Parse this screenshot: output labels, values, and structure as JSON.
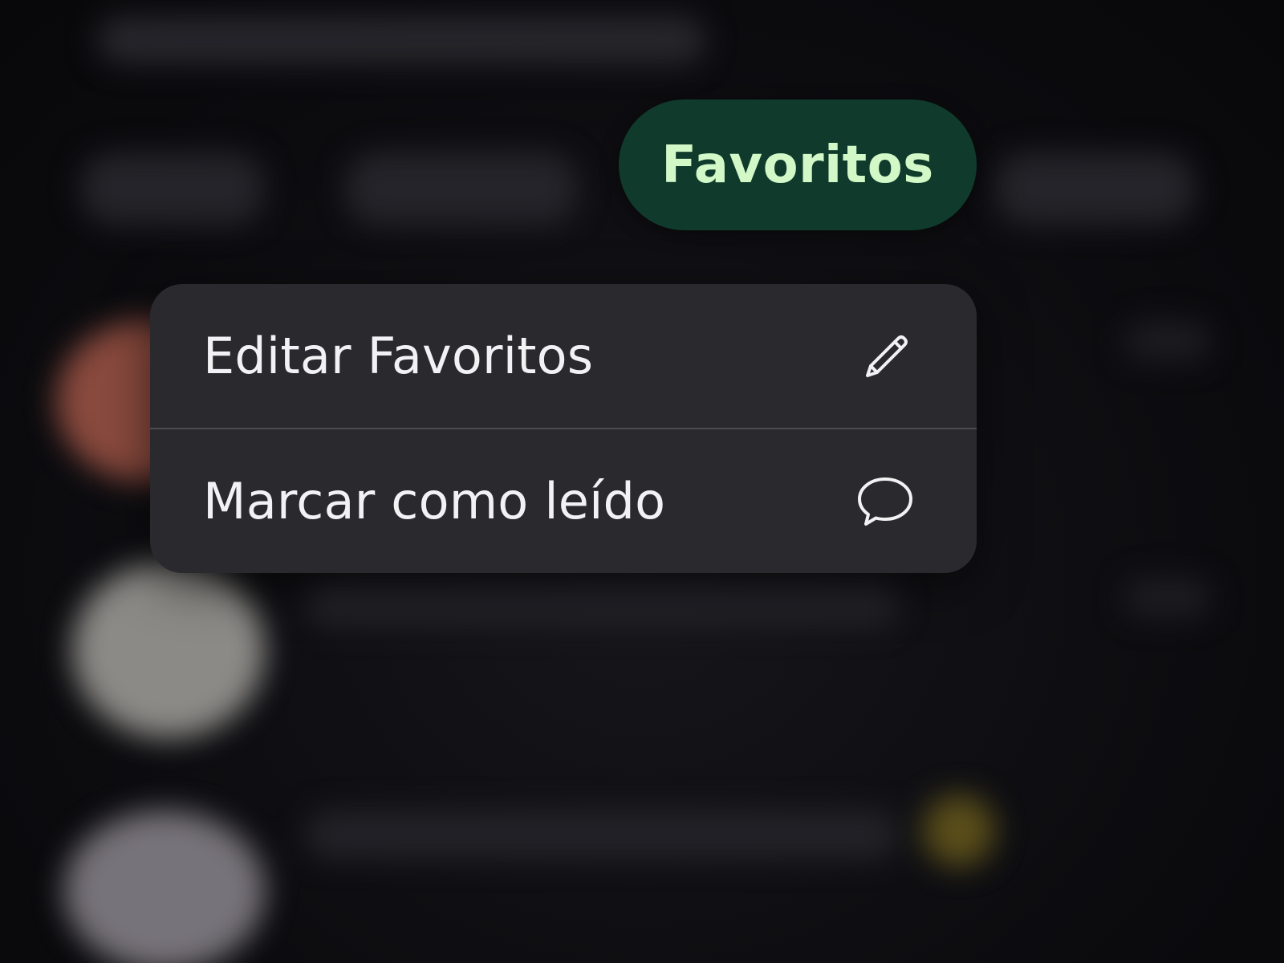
{
  "filter_chip": {
    "label": "Favoritos",
    "background": "#103b2c",
    "text_color": "#d2f8c8"
  },
  "context_menu": {
    "items": [
      {
        "label": "Editar Favoritos",
        "icon": "pencil-icon"
      },
      {
        "label": "Marcar como leído",
        "icon": "chat-bubble-icon"
      }
    ]
  }
}
